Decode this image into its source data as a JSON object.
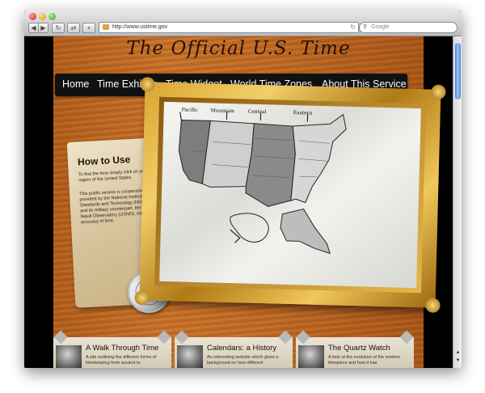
{
  "browser": {
    "url": "http://www.ustime.gov",
    "search_placeholder": "Google"
  },
  "page": {
    "title": "The Official U.S. Time",
    "nav": [
      "Home",
      "Time Exhibits",
      "Time Widget",
      "World Time Zones",
      "About This Service"
    ]
  },
  "how_to": {
    "heading": "How to Use",
    "line1": "To find the time simply click on your region of the United States.",
    "line2": "This public service is cooperatively provided by the National Institute of Standards and Technology (NIST), and its military counterpart, the U. S. Naval Observatory (USNO). Insuring accuracy of time."
  },
  "map": {
    "zones": [
      "Pacific",
      "Mountain",
      "Central",
      "Eastern"
    ]
  },
  "exhibits": [
    {
      "title": "A Walk Through Time",
      "desc": "A site outlining the different forms of timekeeping from ancient to"
    },
    {
      "title": "Calendars: a History",
      "desc": "An interesting website which gives a background on how different"
    },
    {
      "title": "The Quartz Watch",
      "desc": "A look at the evolution of the modern timepiece and how it has"
    }
  ]
}
